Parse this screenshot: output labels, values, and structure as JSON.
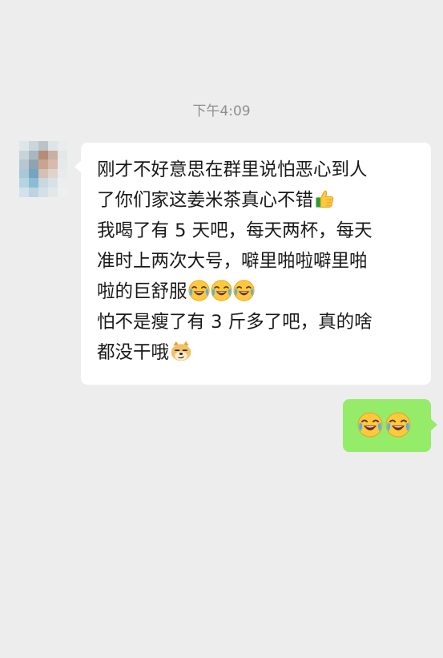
{
  "chat": {
    "timestamp": "下午4:09",
    "received_message": {
      "lines": [
        "刚才不好意思在群里说怕恶心到人",
        "了你们家这姜米茶真心不错",
        "我喝了有 5 天吧，每天两杯，每天",
        "准时上两次大号，噼里啪啦噼里啪",
        "啦的巨舒服",
        "怕不是瘦了有 3 斤多了吧，真的啥",
        "都没干哦"
      ],
      "emoji": {
        "line_2": "thumbs-up-icon",
        "line_5": [
          "laughing-crying-icon",
          "laughing-crying-icon",
          "laughing-crying-icon"
        ],
        "line_7": "doge-icon"
      }
    },
    "sent_message": {
      "emoji": [
        "laughing-crying-icon",
        "laughing-crying-icon"
      ]
    },
    "colors": {
      "background": "#ededed",
      "received_bubble": "#ffffff",
      "sent_bubble": "#95ec69",
      "timestamp_text": "#8f8f8f"
    }
  }
}
